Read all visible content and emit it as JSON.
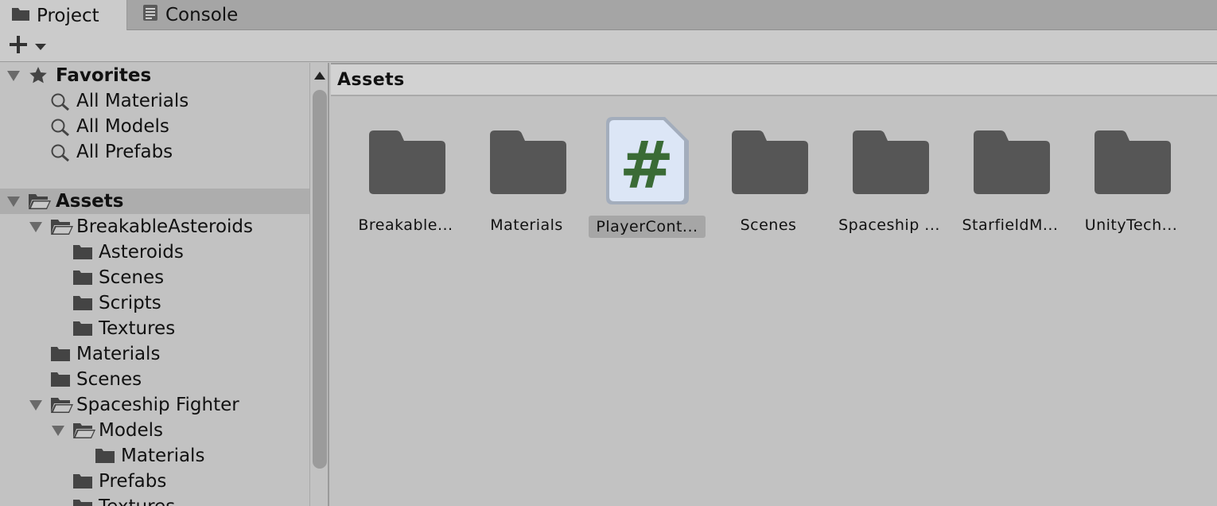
{
  "tabs": [
    {
      "label": "Project",
      "icon": "folder-icon"
    },
    {
      "label": "Console",
      "icon": "console-icon"
    }
  ],
  "toolbar": {
    "create_icon": "plus-icon"
  },
  "tree": {
    "favorites": {
      "label": "Favorites",
      "items": [
        "All Materials",
        "All Models",
        "All Prefabs"
      ]
    },
    "assets": {
      "label": "Assets",
      "items": [
        {
          "label": "BreakableAsteroids",
          "expanded": true
        },
        {
          "label": "Asteroids"
        },
        {
          "label": "Scenes"
        },
        {
          "label": "Scripts"
        },
        {
          "label": "Textures"
        },
        {
          "label": "Materials"
        },
        {
          "label": "Scenes"
        },
        {
          "label": "Spaceship Fighter",
          "expanded": true
        },
        {
          "label": "Models",
          "expanded": true
        },
        {
          "label": "Materials"
        },
        {
          "label": "Prefabs"
        },
        {
          "label": "Textures"
        }
      ]
    }
  },
  "grid": {
    "title": "Assets",
    "items": [
      {
        "label": "Breakable...",
        "kind": "folder"
      },
      {
        "label": "Materials",
        "kind": "folder"
      },
      {
        "label": "PlayerCont...",
        "kind": "script",
        "glyph": "#",
        "selected": true
      },
      {
        "label": "Scenes",
        "kind": "folder"
      },
      {
        "label": "Spaceship ...",
        "kind": "folder"
      },
      {
        "label": "StarfieldM...",
        "kind": "folder"
      },
      {
        "label": "UnityTech...",
        "kind": "folder"
      }
    ]
  },
  "colors": {
    "folder": "#565656",
    "script_bg": "#dce6f6",
    "script_glyph": "#3a6b35",
    "selection": "#adadad"
  }
}
